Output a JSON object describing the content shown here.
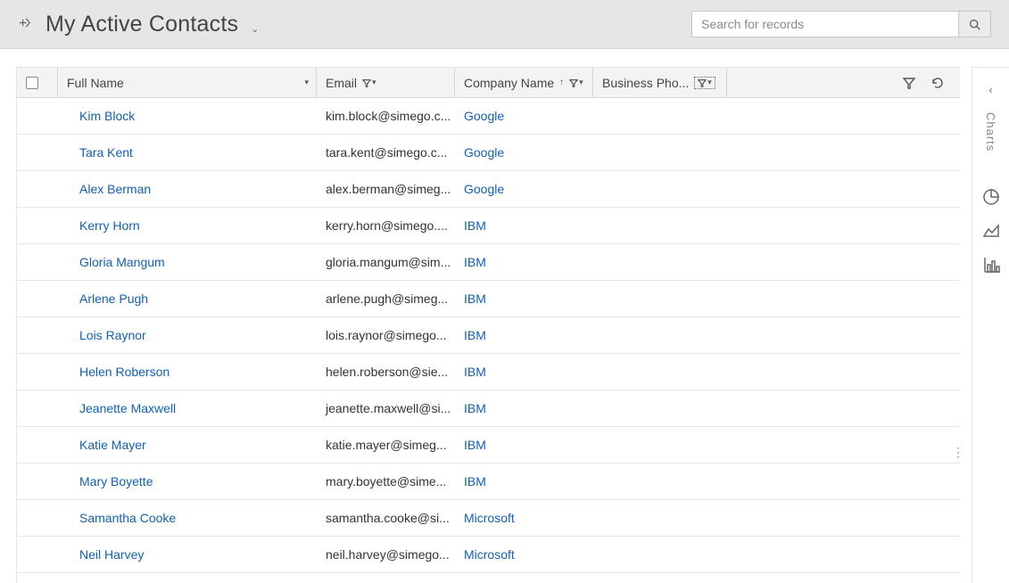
{
  "view": {
    "title": "My Active Contacts"
  },
  "search": {
    "placeholder": "Search for records",
    "value": ""
  },
  "charts": {
    "label": "Charts"
  },
  "columns": {
    "full_name": "Full Name",
    "email": "Email",
    "company": "Company Name",
    "phone": "Business Pho..."
  },
  "sort_indicator": "↑",
  "rows": [
    {
      "name": "Kim Block",
      "email": "kim.block@simego.c...",
      "company": "Google"
    },
    {
      "name": "Tara Kent",
      "email": "tara.kent@simego.c...",
      "company": "Google"
    },
    {
      "name": "Alex Berman",
      "email": "alex.berman@simeg...",
      "company": "Google"
    },
    {
      "name": "Kerry Horn",
      "email": "kerry.horn@simego....",
      "company": "IBM"
    },
    {
      "name": "Gloria Mangum",
      "email": "gloria.mangum@sim...",
      "company": "IBM"
    },
    {
      "name": "Arlene Pugh",
      "email": "arlene.pugh@simeg...",
      "company": "IBM"
    },
    {
      "name": "Lois Raynor",
      "email": "lois.raynor@simego...",
      "company": "IBM"
    },
    {
      "name": "Helen Roberson",
      "email": "helen.roberson@sie...",
      "company": "IBM"
    },
    {
      "name": "Jeanette Maxwell",
      "email": "jeanette.maxwell@si...",
      "company": "IBM"
    },
    {
      "name": "Katie Mayer",
      "email": "katie.mayer@simeg...",
      "company": "IBM"
    },
    {
      "name": "Mary Boyette",
      "email": "mary.boyette@sime...",
      "company": "IBM"
    },
    {
      "name": "Samantha Cooke",
      "email": "samantha.cooke@si...",
      "company": "Microsoft"
    },
    {
      "name": "Neil Harvey",
      "email": "neil.harvey@simego...",
      "company": "Microsoft"
    }
  ]
}
